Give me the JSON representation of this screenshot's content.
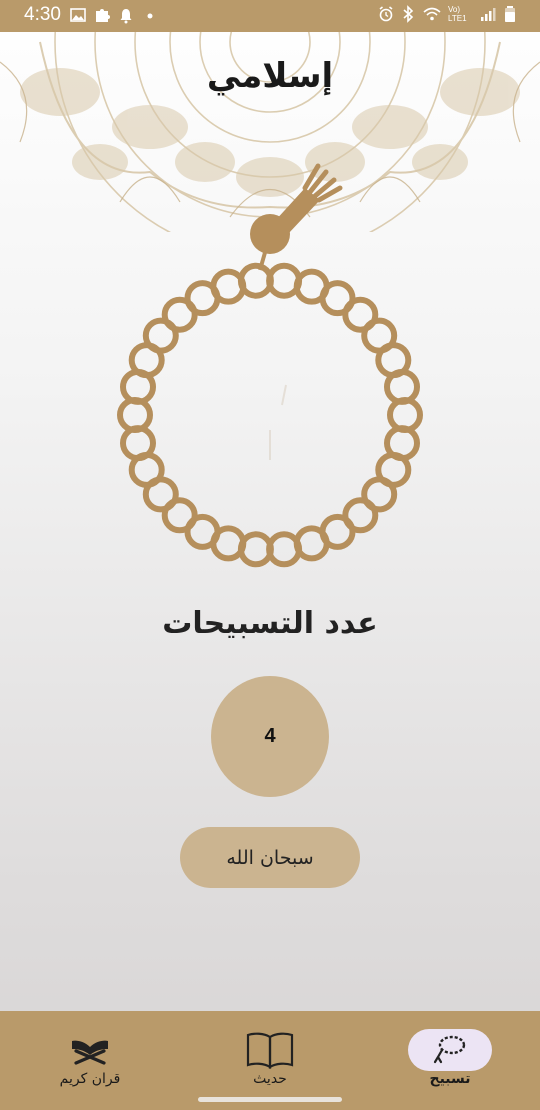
{
  "status_bar": {
    "time": "4:30",
    "network_label": "Vo) LTE1"
  },
  "app": {
    "title": "إسلامي"
  },
  "tasbih": {
    "count_label": "عدد التسبيحات",
    "count": "4",
    "dhikr_label": "سبحان الله"
  },
  "bottom_nav": {
    "items": [
      {
        "label": "تسبيح",
        "icon": "tasbih-icon",
        "active": true
      },
      {
        "label": "حديث",
        "icon": "book-icon",
        "active": false
      },
      {
        "label": "قران كريم",
        "icon": "quran-stand-icon",
        "active": false
      }
    ]
  },
  "colors": {
    "accent": "#b99a6a",
    "bead": "#b58f5c",
    "counter_fill": "#cbb490",
    "active_pill": "#ece4f4"
  }
}
